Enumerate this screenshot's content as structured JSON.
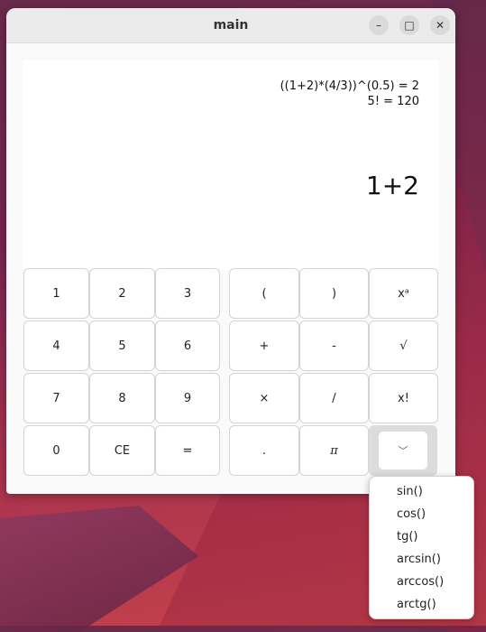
{
  "window": {
    "title": "main"
  },
  "titlebar_buttons": {
    "minimize": "–",
    "maximize": "□",
    "close": "✕"
  },
  "display": {
    "history": [
      "((1+2)*(4/3))^(0.5) = 2",
      "5! = 120"
    ],
    "current": "1+2"
  },
  "keypad": {
    "k1": "1",
    "k2": "2",
    "k3": "3",
    "open": "(",
    "close": ")",
    "pow": "xᵃ",
    "k4": "4",
    "k5": "5",
    "k6": "6",
    "plus": "+",
    "minus": "-",
    "sqrt": "√",
    "k7": "7",
    "k8": "8",
    "k9": "9",
    "times": "×",
    "divide": "/",
    "fact": "x!",
    "k0": "0",
    "ce": "CE",
    "eq": "=",
    "dot": ".",
    "pi": "π",
    "more": "﹀"
  },
  "popup": {
    "items": [
      "sin()",
      "cos()",
      "tg()",
      "arcsin()",
      "arccos()",
      "arctg()"
    ]
  }
}
